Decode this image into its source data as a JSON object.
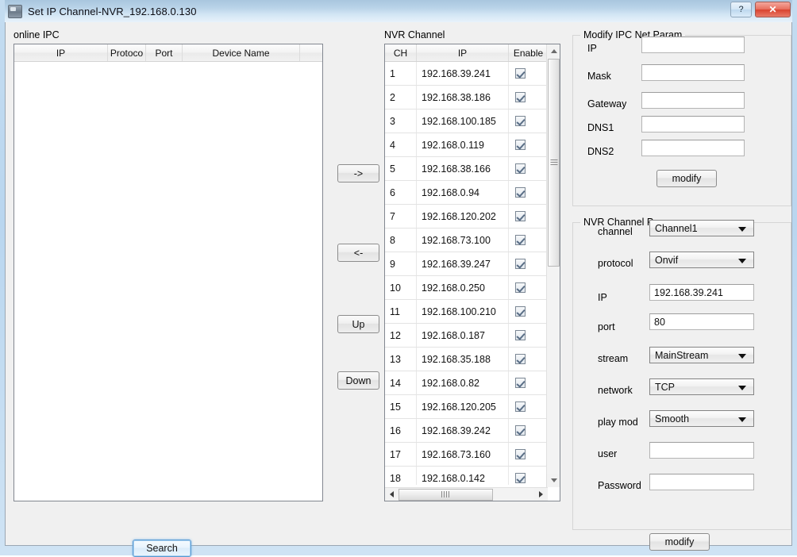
{
  "window": {
    "title": "Set IP Channel-NVR_192.168.0.130",
    "help_label": "?",
    "close_label": "✕"
  },
  "online_ipc": {
    "group_label": "online IPC",
    "columns": [
      "IP",
      "Protoco",
      "Port",
      "Device Name",
      ""
    ],
    "rows": [],
    "search_label": "Search"
  },
  "transfer": {
    "add_label": "->",
    "remove_label": "<-",
    "up_label": "Up",
    "down_label": "Down"
  },
  "nvr_channel": {
    "group_label": "NVR Channel",
    "columns": [
      "CH",
      "IP",
      "Enable"
    ],
    "rows": [
      {
        "ch": "1",
        "ip": "192.168.39.241",
        "enable": true
      },
      {
        "ch": "2",
        "ip": "192.168.38.186",
        "enable": true
      },
      {
        "ch": "3",
        "ip": "192.168.100.185",
        "enable": true
      },
      {
        "ch": "4",
        "ip": "192.168.0.119",
        "enable": true
      },
      {
        "ch": "5",
        "ip": "192.168.38.166",
        "enable": true
      },
      {
        "ch": "6",
        "ip": "192.168.0.94",
        "enable": true
      },
      {
        "ch": "7",
        "ip": "192.168.120.202",
        "enable": true
      },
      {
        "ch": "8",
        "ip": "192.168.73.100",
        "enable": true
      },
      {
        "ch": "9",
        "ip": "192.168.39.247",
        "enable": true
      },
      {
        "ch": "10",
        "ip": "192.168.0.250",
        "enable": true
      },
      {
        "ch": "11",
        "ip": "192.168.100.210",
        "enable": true
      },
      {
        "ch": "12",
        "ip": "192.168.0.187",
        "enable": true
      },
      {
        "ch": "13",
        "ip": "192.168.35.188",
        "enable": true
      },
      {
        "ch": "14",
        "ip": "192.168.0.82",
        "enable": true
      },
      {
        "ch": "15",
        "ip": "192.168.120.205",
        "enable": true
      },
      {
        "ch": "16",
        "ip": "192.168.39.242",
        "enable": true
      },
      {
        "ch": "17",
        "ip": "192.168.73.160",
        "enable": true
      },
      {
        "ch": "18",
        "ip": "192.168.0.142",
        "enable": true
      }
    ]
  },
  "ipc_net_param": {
    "group_label": "Modify IPC Net Param",
    "fields": [
      {
        "label": "IP",
        "value": ""
      },
      {
        "label": "Mask",
        "value": ""
      },
      {
        "label": "Gateway",
        "value": ""
      },
      {
        "label": "DNS1",
        "value": ""
      },
      {
        "label": "DNS2",
        "value": ""
      }
    ],
    "modify_label": "modify"
  },
  "nvr_channel_param": {
    "group_label": "NVR Channel Param",
    "channel": {
      "label": "channel",
      "value": "Channel1"
    },
    "protocol": {
      "label": "protocol",
      "value": "Onvif"
    },
    "ip": {
      "label": "IP",
      "value": "192.168.39.241"
    },
    "port": {
      "label": "port",
      "value": "80"
    },
    "stream": {
      "label": "stream",
      "value": "MainStream"
    },
    "network": {
      "label": "network",
      "value": "TCP"
    },
    "play_mode": {
      "label": "play mod",
      "value": "Smooth"
    },
    "user": {
      "label": "user",
      "value": ""
    },
    "password": {
      "label": "Password",
      "value": ""
    },
    "modify_label": "modify"
  }
}
